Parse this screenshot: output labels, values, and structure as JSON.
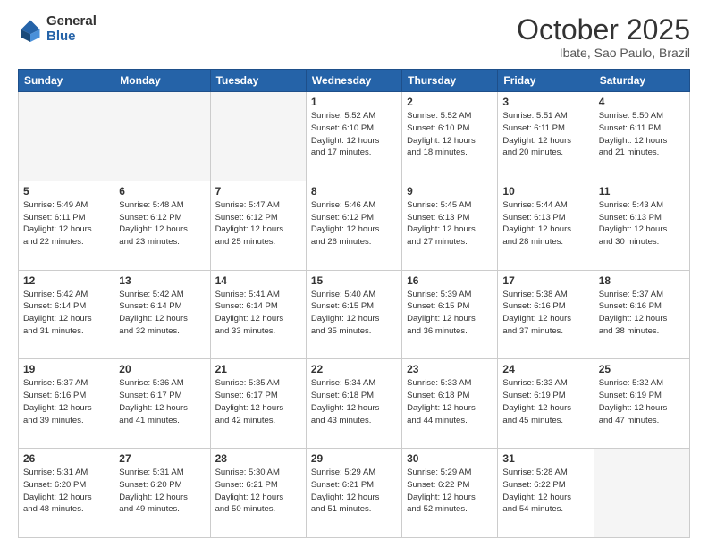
{
  "header": {
    "logo_general": "General",
    "logo_blue": "Blue",
    "month_title": "October 2025",
    "location": "Ibate, Sao Paulo, Brazil"
  },
  "weekdays": [
    "Sunday",
    "Monday",
    "Tuesday",
    "Wednesday",
    "Thursday",
    "Friday",
    "Saturday"
  ],
  "weeks": [
    [
      {
        "day": "",
        "info": ""
      },
      {
        "day": "",
        "info": ""
      },
      {
        "day": "",
        "info": ""
      },
      {
        "day": "1",
        "info": "Sunrise: 5:52 AM\nSunset: 6:10 PM\nDaylight: 12 hours\nand 17 minutes."
      },
      {
        "day": "2",
        "info": "Sunrise: 5:52 AM\nSunset: 6:10 PM\nDaylight: 12 hours\nand 18 minutes."
      },
      {
        "day": "3",
        "info": "Sunrise: 5:51 AM\nSunset: 6:11 PM\nDaylight: 12 hours\nand 20 minutes."
      },
      {
        "day": "4",
        "info": "Sunrise: 5:50 AM\nSunset: 6:11 PM\nDaylight: 12 hours\nand 21 minutes."
      }
    ],
    [
      {
        "day": "5",
        "info": "Sunrise: 5:49 AM\nSunset: 6:11 PM\nDaylight: 12 hours\nand 22 minutes."
      },
      {
        "day": "6",
        "info": "Sunrise: 5:48 AM\nSunset: 6:12 PM\nDaylight: 12 hours\nand 23 minutes."
      },
      {
        "day": "7",
        "info": "Sunrise: 5:47 AM\nSunset: 6:12 PM\nDaylight: 12 hours\nand 25 minutes."
      },
      {
        "day": "8",
        "info": "Sunrise: 5:46 AM\nSunset: 6:12 PM\nDaylight: 12 hours\nand 26 minutes."
      },
      {
        "day": "9",
        "info": "Sunrise: 5:45 AM\nSunset: 6:13 PM\nDaylight: 12 hours\nand 27 minutes."
      },
      {
        "day": "10",
        "info": "Sunrise: 5:44 AM\nSunset: 6:13 PM\nDaylight: 12 hours\nand 28 minutes."
      },
      {
        "day": "11",
        "info": "Sunrise: 5:43 AM\nSunset: 6:13 PM\nDaylight: 12 hours\nand 30 minutes."
      }
    ],
    [
      {
        "day": "12",
        "info": "Sunrise: 5:42 AM\nSunset: 6:14 PM\nDaylight: 12 hours\nand 31 minutes."
      },
      {
        "day": "13",
        "info": "Sunrise: 5:42 AM\nSunset: 6:14 PM\nDaylight: 12 hours\nand 32 minutes."
      },
      {
        "day": "14",
        "info": "Sunrise: 5:41 AM\nSunset: 6:14 PM\nDaylight: 12 hours\nand 33 minutes."
      },
      {
        "day": "15",
        "info": "Sunrise: 5:40 AM\nSunset: 6:15 PM\nDaylight: 12 hours\nand 35 minutes."
      },
      {
        "day": "16",
        "info": "Sunrise: 5:39 AM\nSunset: 6:15 PM\nDaylight: 12 hours\nand 36 minutes."
      },
      {
        "day": "17",
        "info": "Sunrise: 5:38 AM\nSunset: 6:16 PM\nDaylight: 12 hours\nand 37 minutes."
      },
      {
        "day": "18",
        "info": "Sunrise: 5:37 AM\nSunset: 6:16 PM\nDaylight: 12 hours\nand 38 minutes."
      }
    ],
    [
      {
        "day": "19",
        "info": "Sunrise: 5:37 AM\nSunset: 6:16 PM\nDaylight: 12 hours\nand 39 minutes."
      },
      {
        "day": "20",
        "info": "Sunrise: 5:36 AM\nSunset: 6:17 PM\nDaylight: 12 hours\nand 41 minutes."
      },
      {
        "day": "21",
        "info": "Sunrise: 5:35 AM\nSunset: 6:17 PM\nDaylight: 12 hours\nand 42 minutes."
      },
      {
        "day": "22",
        "info": "Sunrise: 5:34 AM\nSunset: 6:18 PM\nDaylight: 12 hours\nand 43 minutes."
      },
      {
        "day": "23",
        "info": "Sunrise: 5:33 AM\nSunset: 6:18 PM\nDaylight: 12 hours\nand 44 minutes."
      },
      {
        "day": "24",
        "info": "Sunrise: 5:33 AM\nSunset: 6:19 PM\nDaylight: 12 hours\nand 45 minutes."
      },
      {
        "day": "25",
        "info": "Sunrise: 5:32 AM\nSunset: 6:19 PM\nDaylight: 12 hours\nand 47 minutes."
      }
    ],
    [
      {
        "day": "26",
        "info": "Sunrise: 5:31 AM\nSunset: 6:20 PM\nDaylight: 12 hours\nand 48 minutes."
      },
      {
        "day": "27",
        "info": "Sunrise: 5:31 AM\nSunset: 6:20 PM\nDaylight: 12 hours\nand 49 minutes."
      },
      {
        "day": "28",
        "info": "Sunrise: 5:30 AM\nSunset: 6:21 PM\nDaylight: 12 hours\nand 50 minutes."
      },
      {
        "day": "29",
        "info": "Sunrise: 5:29 AM\nSunset: 6:21 PM\nDaylight: 12 hours\nand 51 minutes."
      },
      {
        "day": "30",
        "info": "Sunrise: 5:29 AM\nSunset: 6:22 PM\nDaylight: 12 hours\nand 52 minutes."
      },
      {
        "day": "31",
        "info": "Sunrise: 5:28 AM\nSunset: 6:22 PM\nDaylight: 12 hours\nand 54 minutes."
      },
      {
        "day": "",
        "info": ""
      }
    ]
  ]
}
